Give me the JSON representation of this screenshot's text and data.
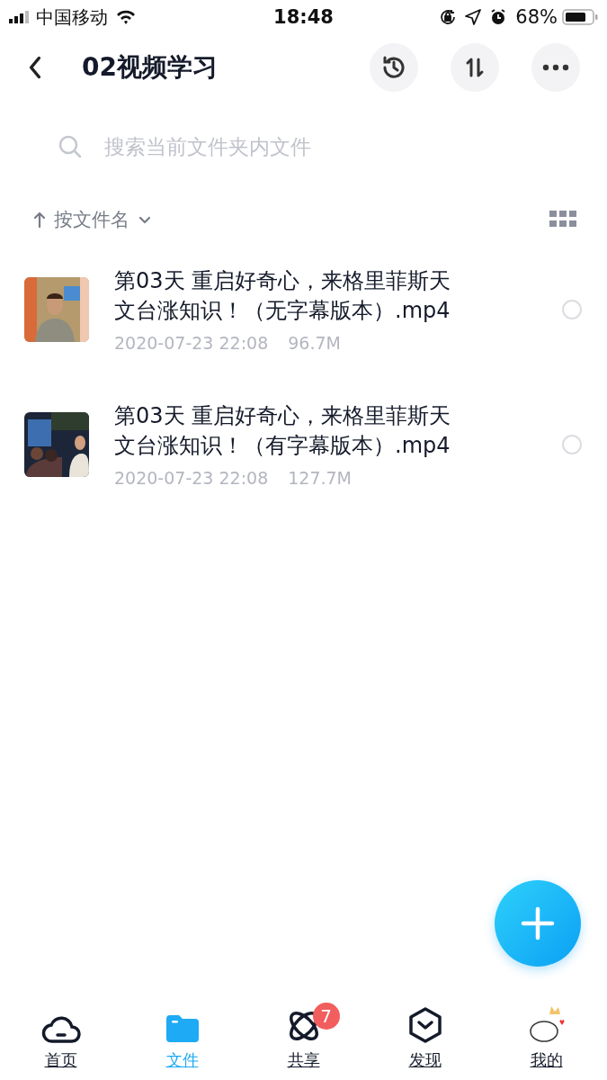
{
  "status_bar": {
    "carrier": "中国移动",
    "time": "18:48",
    "battery": "68%"
  },
  "header": {
    "title": "02视频学习"
  },
  "search": {
    "placeholder": "搜索当前文件夹内文件"
  },
  "sort": {
    "label": "按文件名"
  },
  "files": [
    {
      "name": "第03天 重启好奇心，来格里菲斯天文台涨知识！（无字幕版本）.mp4",
      "date": "2020-07-23 22:08",
      "size": "96.7M",
      "selected": false
    },
    {
      "name": "第03天 重启好奇心，来格里菲斯天文台涨知识！（有字幕版本）.mp4",
      "date": "2020-07-23 22:08",
      "size": "127.7M",
      "selected": false
    }
  ],
  "tab_bar": [
    {
      "label": "首页",
      "selected": false
    },
    {
      "label": "文件",
      "selected": true
    },
    {
      "label": "共享",
      "selected": false,
      "badge": "7"
    },
    {
      "label": "发现",
      "selected": false
    },
    {
      "label": "我的",
      "selected": false
    }
  ]
}
